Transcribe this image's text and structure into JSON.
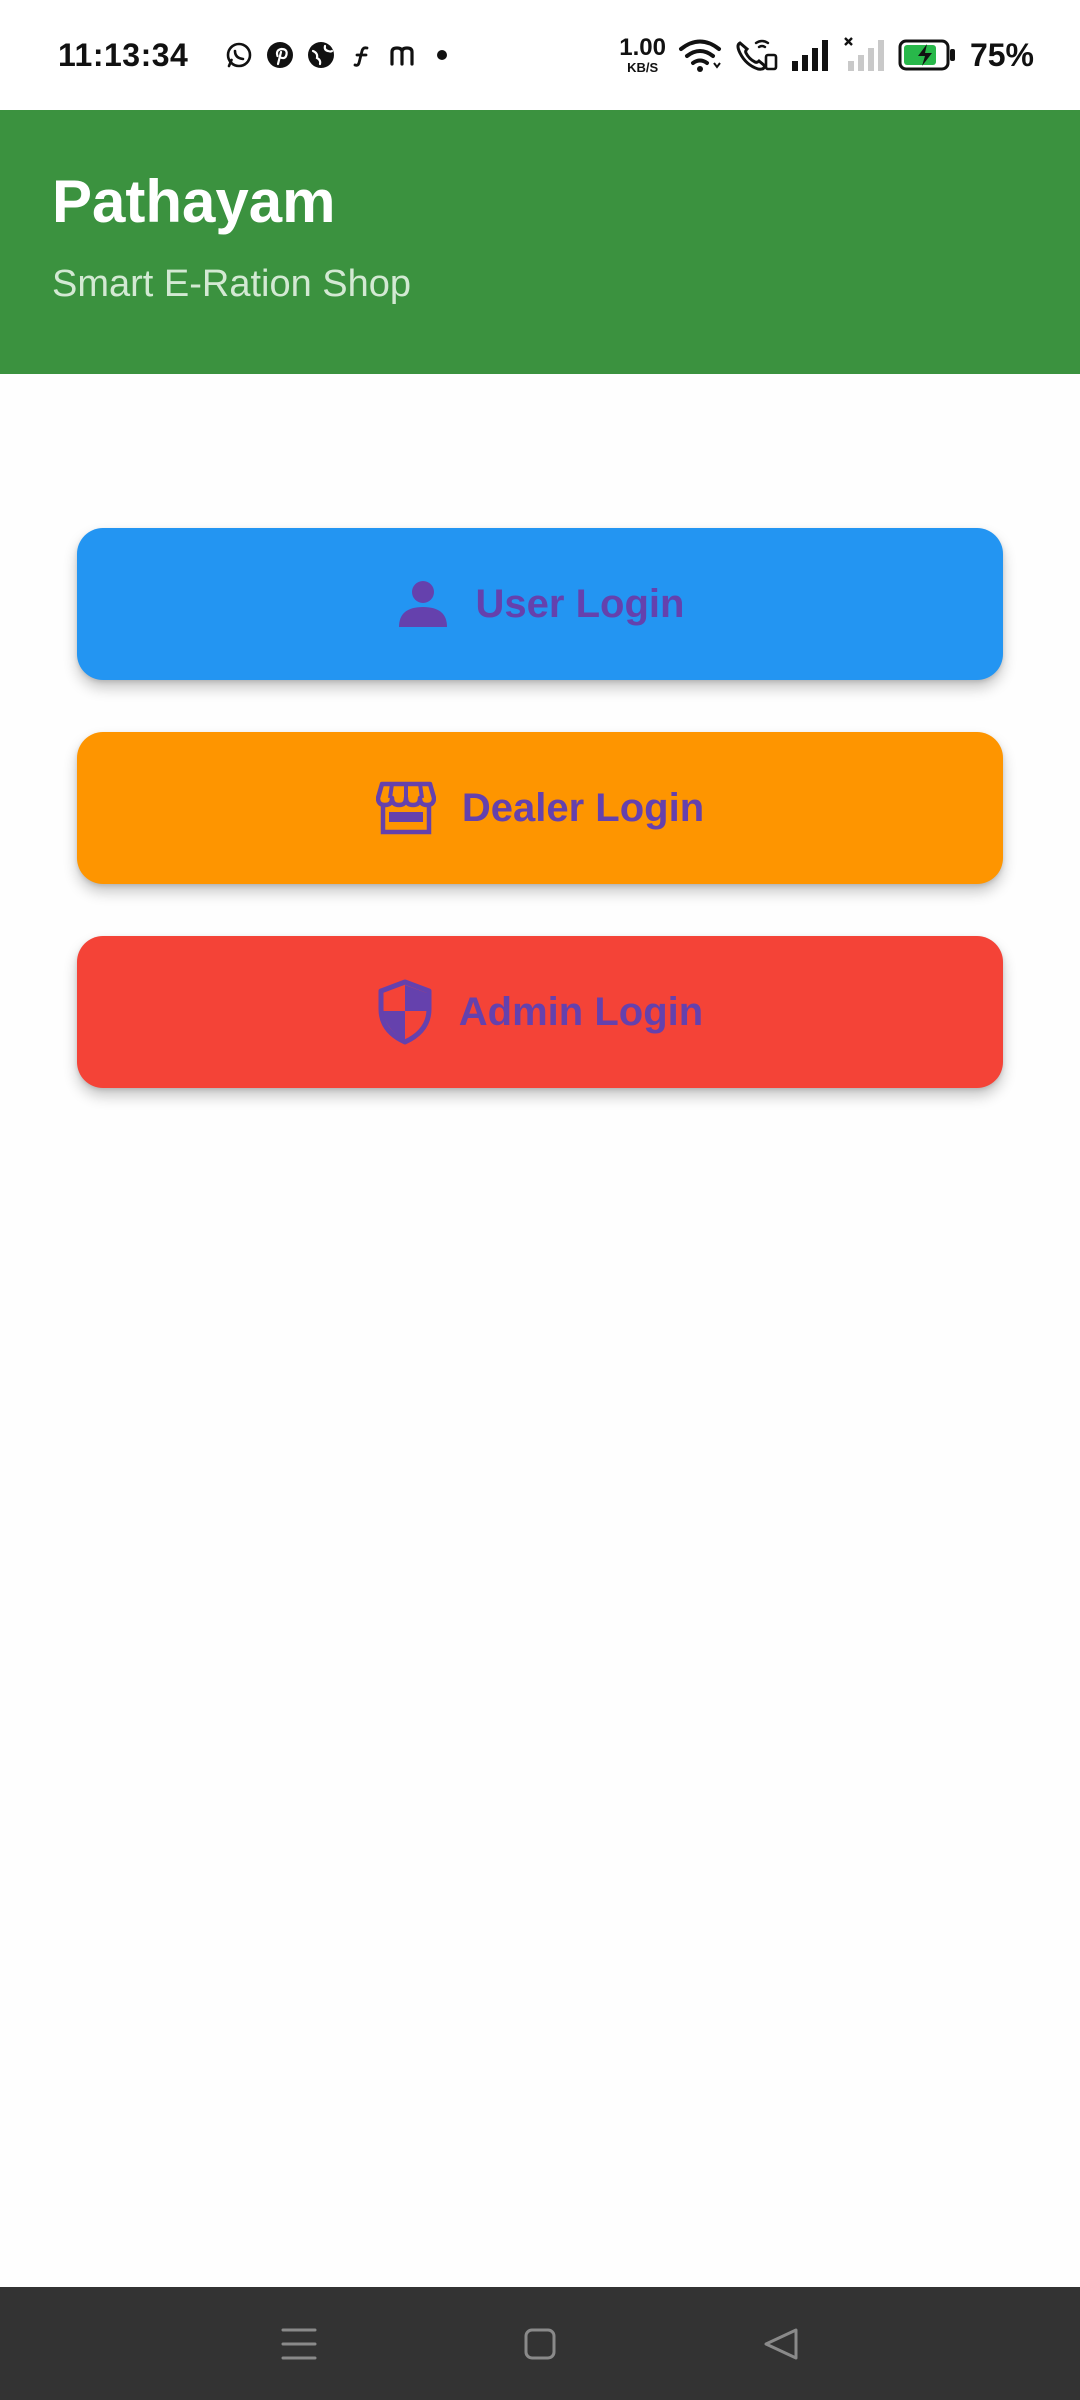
{
  "status_bar": {
    "time": "11:13:34",
    "notification_icons": [
      "whatsapp-icon",
      "pinterest-icon",
      "globe-icon",
      "function-icon",
      "m-icon",
      "dot-icon"
    ],
    "net_speed_value": "1.00",
    "net_speed_unit": "KB/S",
    "battery_percent": "75%"
  },
  "app_bar": {
    "title": "Pathayam",
    "subtitle": "Smart E-Ration Shop",
    "color": "#3b923f"
  },
  "buttons": {
    "user": {
      "label": "User Login",
      "icon": "person-icon",
      "color": "#2395f2"
    },
    "dealer": {
      "label": "Dealer Login",
      "icon": "storefront-icon",
      "color": "#fe9500"
    },
    "admin": {
      "label": "Admin Login",
      "icon": "shield-icon",
      "color": "#f44337"
    },
    "text_color": "#6541ad"
  },
  "nav_bar": {
    "items": [
      "menu-icon",
      "home-icon",
      "back-icon"
    ]
  }
}
